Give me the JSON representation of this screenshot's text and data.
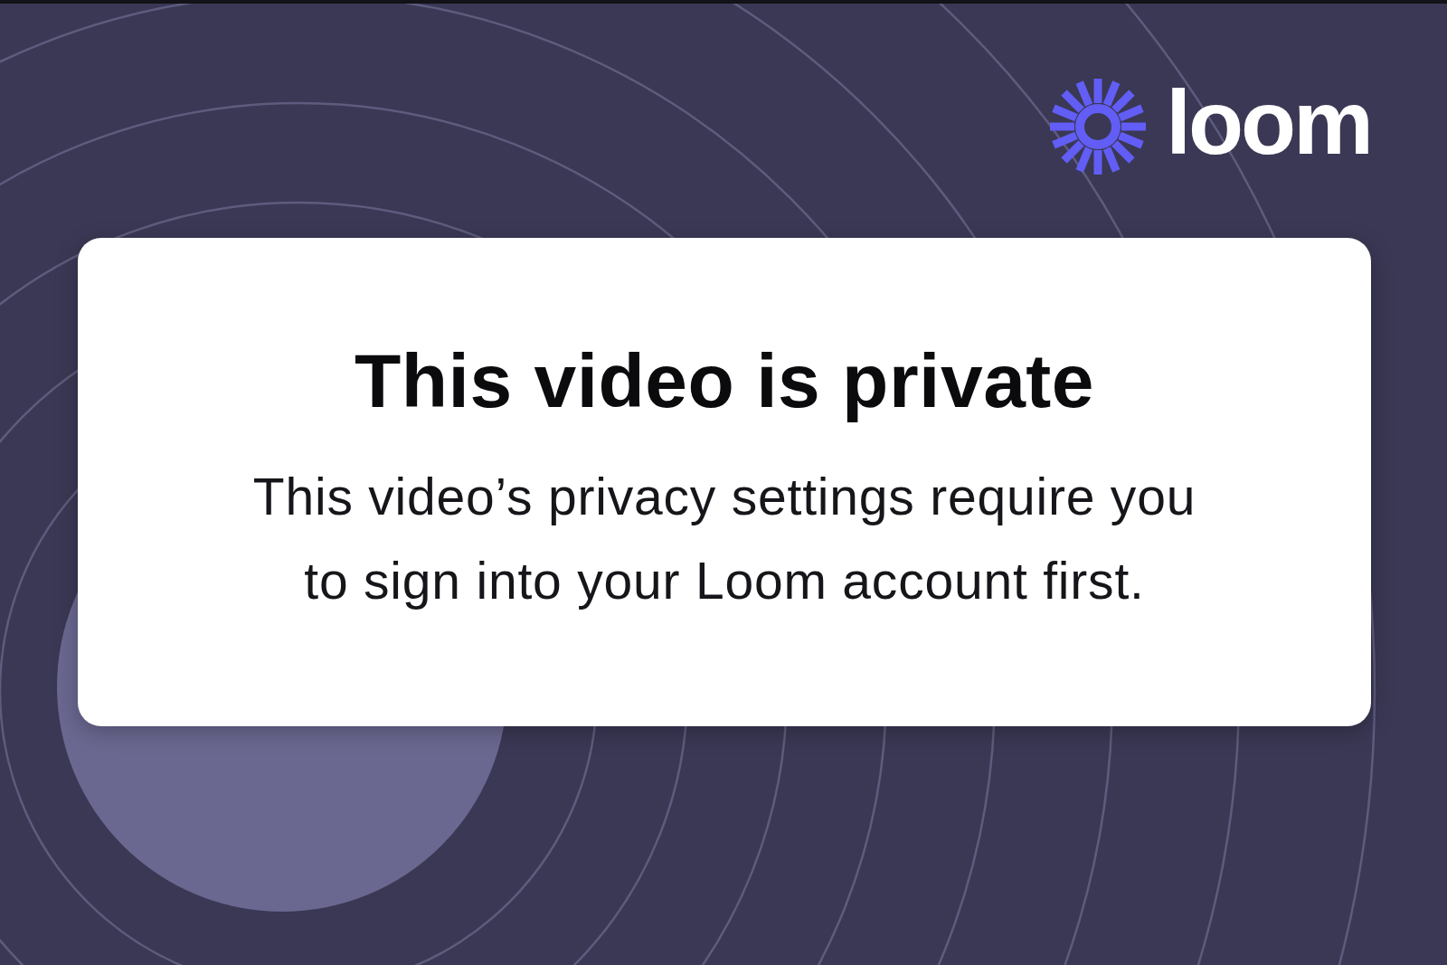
{
  "logo": {
    "wordmark": "loom"
  },
  "card": {
    "title": "This video is private",
    "message": "This video’s privacy settings require you to sign into your Loom account first."
  }
}
